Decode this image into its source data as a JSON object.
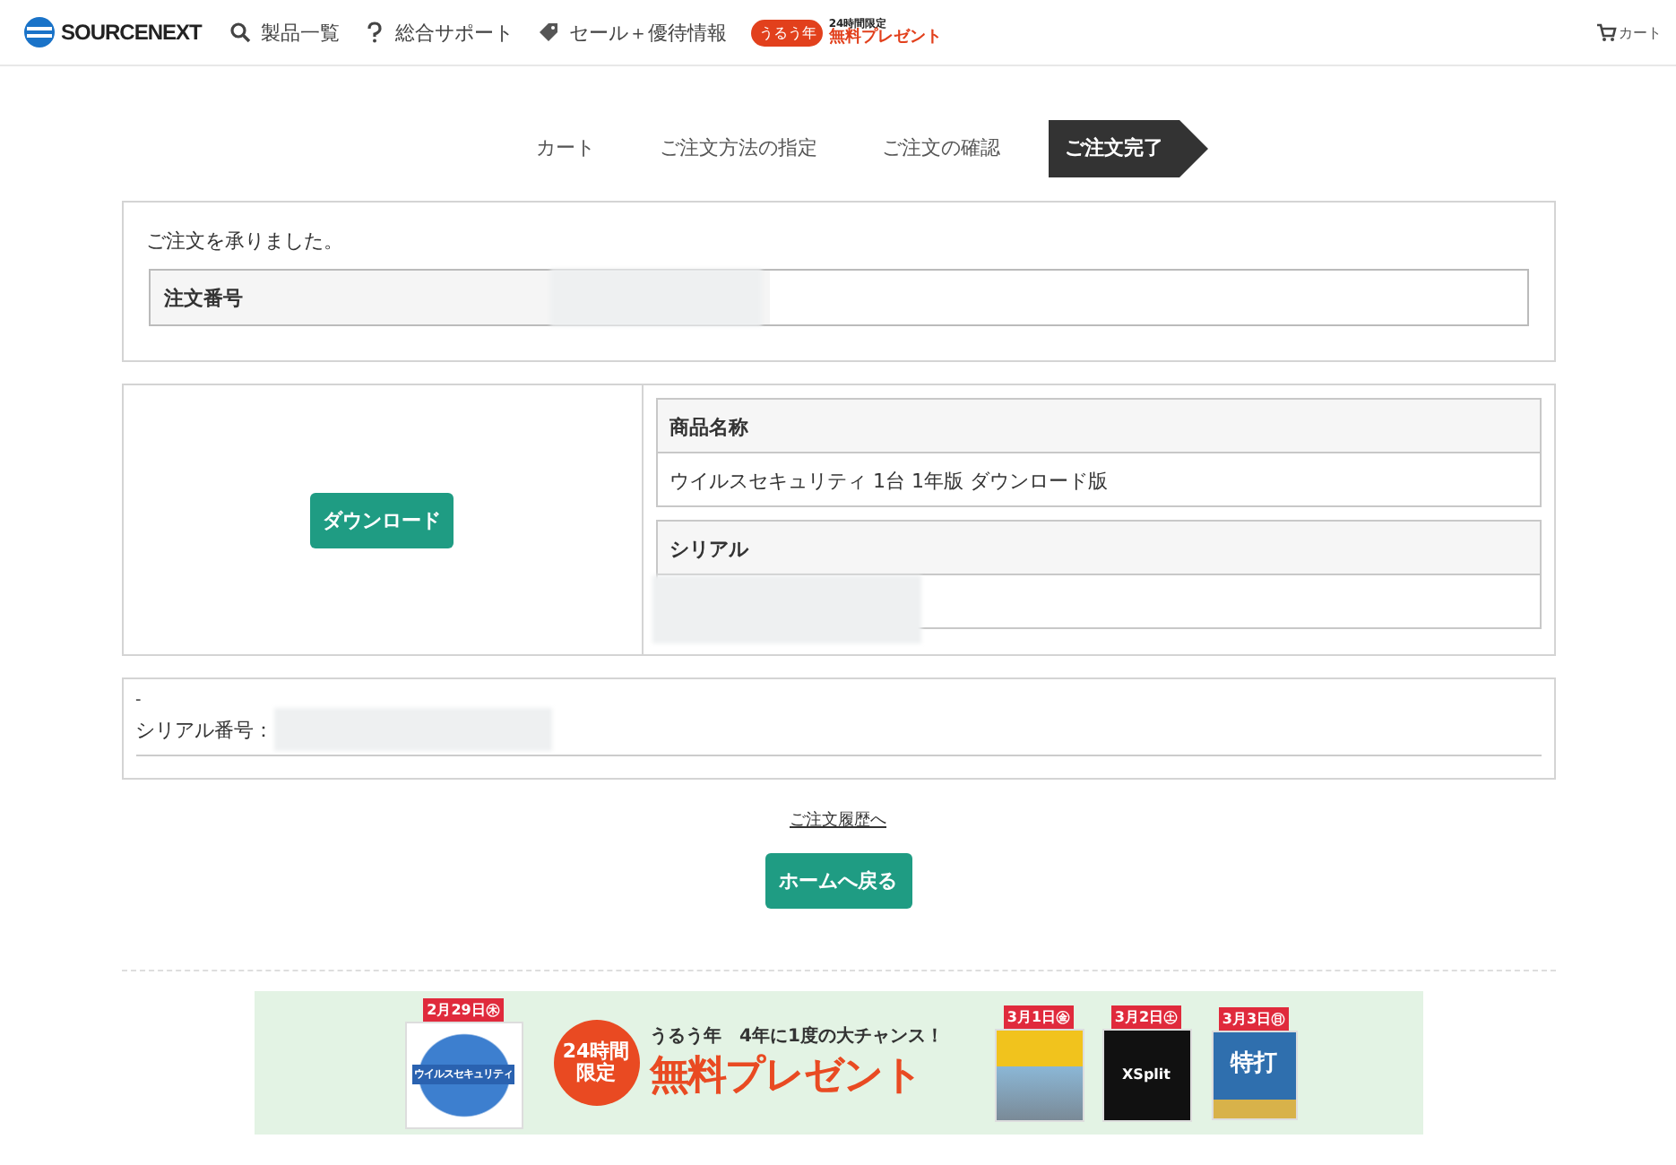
{
  "header": {
    "logo": "SOURCENEXT",
    "nav": [
      {
        "kind": "search",
        "label": "製品一覧"
      },
      {
        "kind": "help",
        "label": "総合サポート"
      },
      {
        "kind": "tag",
        "label": "セール＋優待情報"
      }
    ],
    "promo": {
      "badge": "うるう年",
      "small": "24時間限定",
      "label": "無料プレゼント"
    },
    "cart": "カート"
  },
  "steps": [
    {
      "label": "カート",
      "selected": false
    },
    {
      "label": "ご注文方法の指定",
      "selected": false
    },
    {
      "label": "ご注文の確認",
      "selected": false
    },
    {
      "label": "ご注文完了",
      "selected": true
    }
  ],
  "message": "ご注文を承りました。",
  "order": {
    "label": "注文番号"
  },
  "product": {
    "download_button": "ダウンロード",
    "name_label": "商品名称",
    "name": "ウイルスセキュリティ 1台 1年版 ダウンロード版",
    "serial_label": "シリアル"
  },
  "note": {
    "dash": "-",
    "serial_label": "シリアル番号："
  },
  "history_link": "ご注文履歴へ",
  "home_button": "ホームへ戻る",
  "banner": {
    "lead_date": "2月29日㊍",
    "lead_product": "ウイルスセキュリティ",
    "circle": "24時間限定",
    "headline": "うるう年　4年に1度の大チャンス！",
    "title": "無料プレゼント",
    "items": [
      {
        "date": "3月1日㊎"
      },
      {
        "date": "3月2日㊏",
        "product": "XSplit"
      },
      {
        "date": "3月3日㊐",
        "product": "特打"
      }
    ]
  }
}
